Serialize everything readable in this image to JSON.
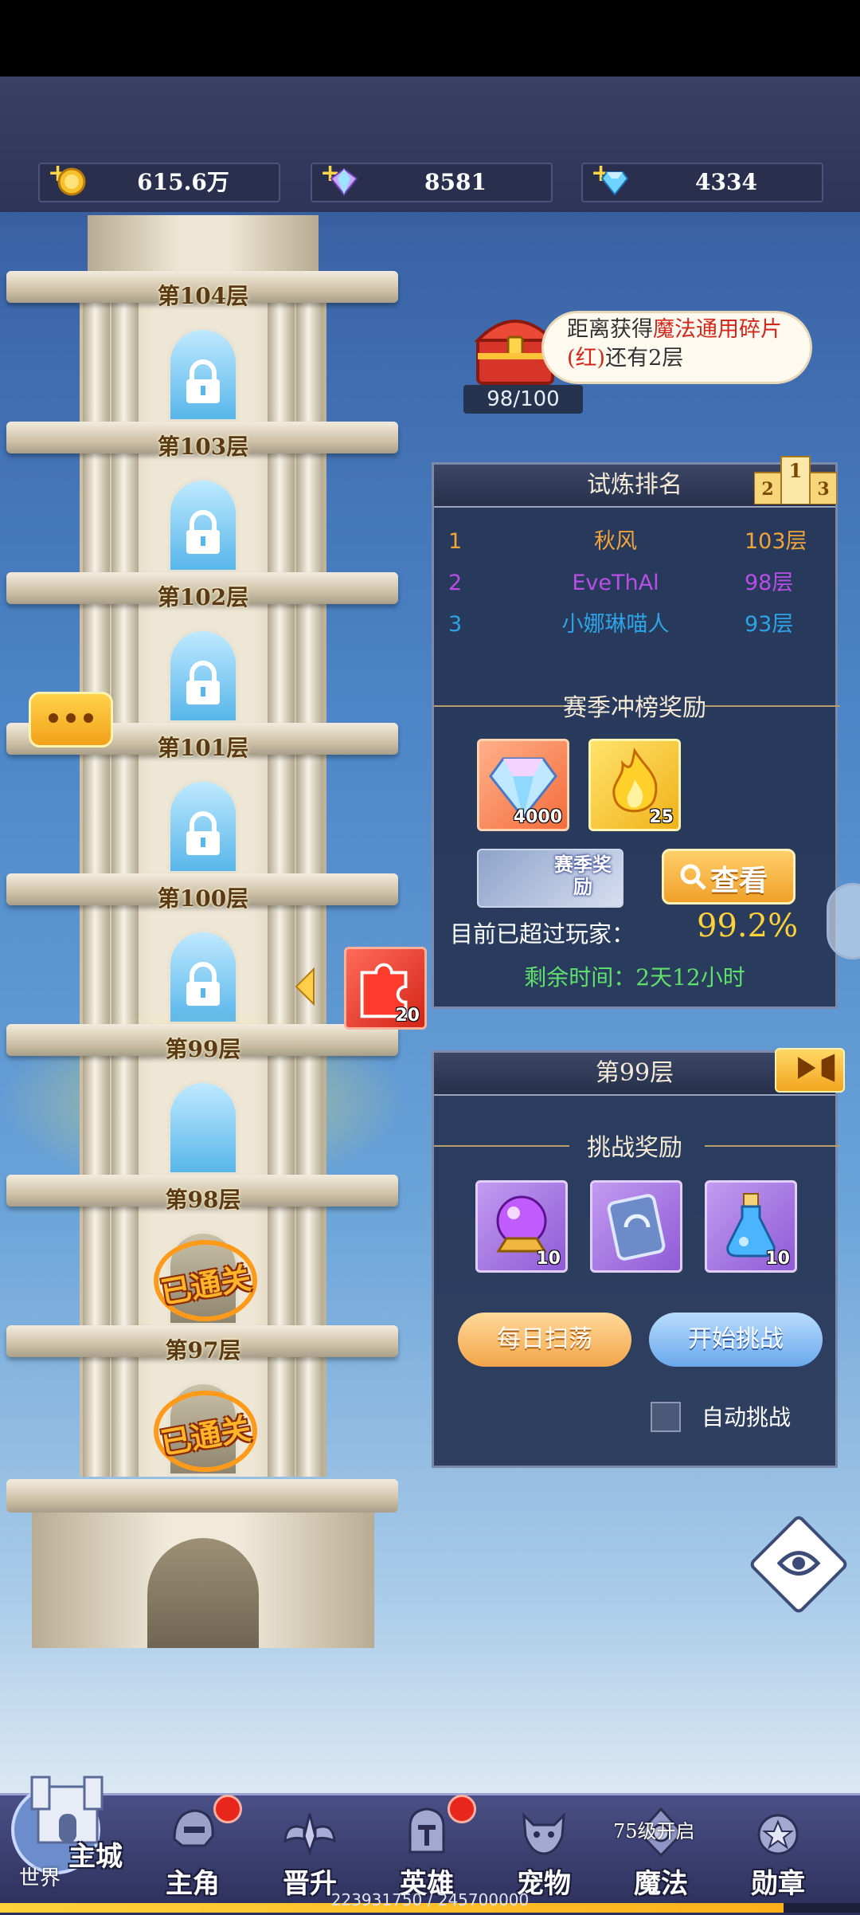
{
  "resources": [
    {
      "icon": "gold-coin-icon",
      "value": "615.6万"
    },
    {
      "icon": "rainbow-gem-icon",
      "value": "8581"
    },
    {
      "icon": "blue-diamond-icon",
      "value": "4334"
    }
  ],
  "tower": {
    "floors": [
      {
        "label": "第104层",
        "status": "locked"
      },
      {
        "label": "第103层",
        "status": "locked"
      },
      {
        "label": "第102层",
        "status": "locked"
      },
      {
        "label": "第101层",
        "status": "locked"
      },
      {
        "label": "第100层",
        "status": "locked"
      },
      {
        "label": "第99层",
        "status": "current"
      },
      {
        "label": "第98层",
        "status": "cleared"
      },
      {
        "label": "第97层",
        "status": "cleared"
      }
    ],
    "cleared_text": "已通关",
    "side_reward_count": "20"
  },
  "chest": {
    "text_prefix": "距离获得",
    "text_highlight": "魔法通用碎片(红)",
    "text_suffix": "还有2层",
    "progress": "98/100",
    "progress_fraction": 0.98
  },
  "ranking": {
    "title": "试炼排名",
    "rows": [
      {
        "rank": "1",
        "name": "秋风",
        "floor": "103层",
        "color": "#f0a53a"
      },
      {
        "rank": "2",
        "name": "EveThAl",
        "floor": "98层",
        "color": "#b84ee6"
      },
      {
        "rank": "3",
        "name": "小娜琳喵人",
        "floor": "93层",
        "color": "#2ea3e6"
      }
    ],
    "season_title": "赛季冲榜奖励",
    "season_rewards": [
      {
        "icon": "diamond-icon",
        "count": "4000"
      },
      {
        "icon": "golden-flame-icon",
        "count": "25"
      }
    ],
    "season_badge": "赛季奖励",
    "view_button": "查看",
    "surpass_label": "目前已超过玩家：",
    "surpass_value": "99.2%",
    "remaining": "剩余时间：2天12小时"
  },
  "floor_panel": {
    "title": "第99层",
    "rewards_title": "挑战奖励",
    "rewards": [
      {
        "icon": "crystal-ball-icon",
        "count": "10"
      },
      {
        "icon": "rune-card-icon",
        "count": ""
      },
      {
        "icon": "potion-icon",
        "count": "10"
      }
    ],
    "sweep_button": "每日扫荡",
    "challenge_button": "开始挑战",
    "auto_label": "自动挑战"
  },
  "bottom_nav": {
    "home_label": "主城",
    "world_label": "世界",
    "items": [
      {
        "label": "主角",
        "icon": "hero-helmet-icon",
        "badge": true
      },
      {
        "label": "晋升",
        "icon": "promotion-wings-icon",
        "badge": false
      },
      {
        "label": "英雄",
        "icon": "knight-helmet-icon",
        "badge": true
      },
      {
        "label": "宠物",
        "icon": "pet-beast-icon",
        "badge": false
      },
      {
        "label": "魔法",
        "icon": "magic-rune-icon",
        "badge": false,
        "lock_text": "75级开启"
      },
      {
        "label": "勋章",
        "icon": "medal-icon",
        "badge": false
      }
    ],
    "exp_text": "223931750 / 245700000",
    "exp_fraction": 0.911
  }
}
